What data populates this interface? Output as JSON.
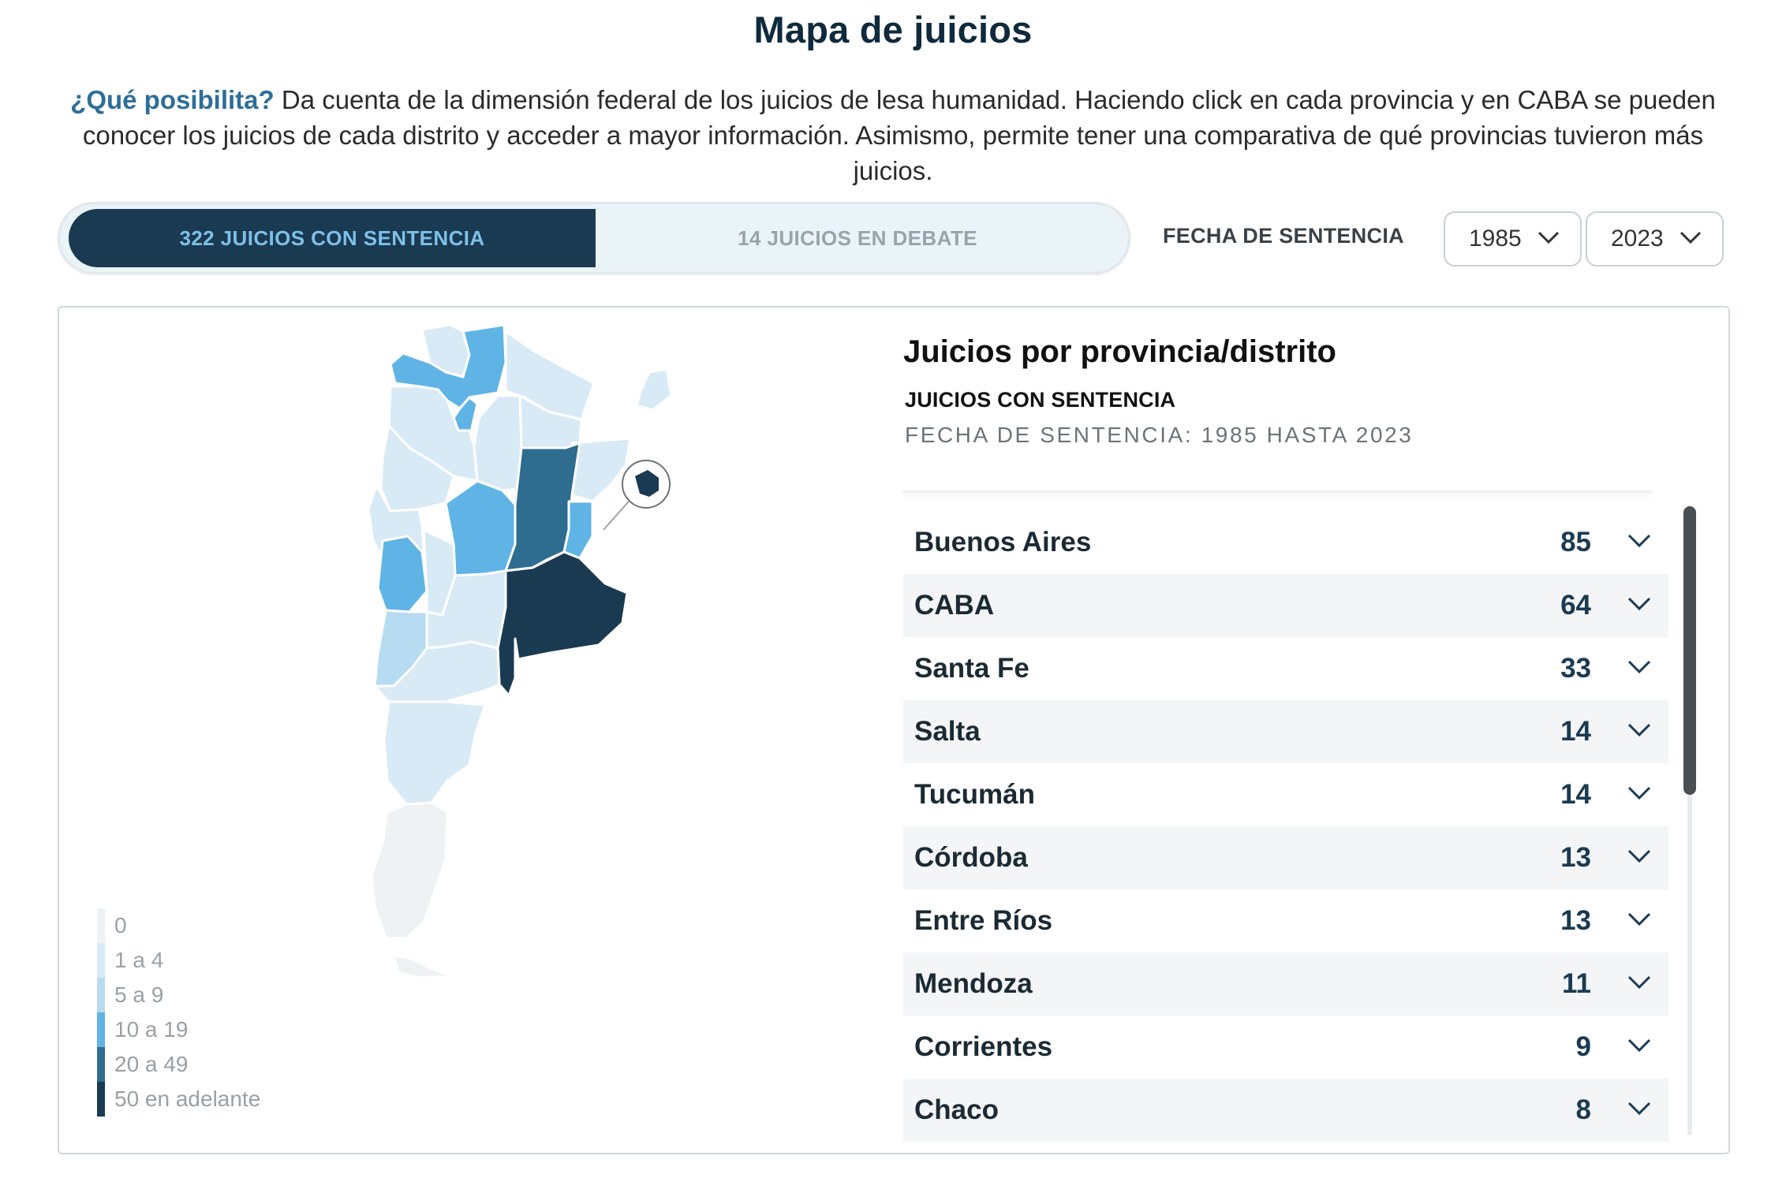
{
  "header": {
    "title": "Mapa de juicios",
    "intro_lead": "¿Qué posibilita?",
    "intro_text": " Da cuenta de la dimensión federal de los juicios de lesa humanidad. Haciendo click en cada provincia y en CABA se pueden conocer los juicios de cada distrito y acceder a mayor información. Asimismo, permite tener una comparativa de qué provincias tuvieron más juicios."
  },
  "toggle": {
    "active_label": "322 JUICIOS CON SENTENCIA",
    "inactive_label": "14 JUICIOS EN DEBATE"
  },
  "filters": {
    "date_label": "FECHA DE SENTENCIA",
    "from_year": "1985",
    "to_year": "2023"
  },
  "panel": {
    "title": "Juicios por provincia/distrito",
    "subtitle": "JUICIOS CON SENTENCIA",
    "range": "FECHA DE SENTENCIA: 1985 HASTA 2023",
    "rows": [
      {
        "name": "Buenos Aires",
        "count": "85"
      },
      {
        "name": "CABA",
        "count": "64"
      },
      {
        "name": "Santa Fe",
        "count": "33"
      },
      {
        "name": "Salta",
        "count": "14"
      },
      {
        "name": "Tucumán",
        "count": "14"
      },
      {
        "name": "Córdoba",
        "count": "13"
      },
      {
        "name": "Entre Ríos",
        "count": "13"
      },
      {
        "name": "Mendoza",
        "count": "11"
      },
      {
        "name": "Corrientes",
        "count": "9"
      },
      {
        "name": "Chaco",
        "count": "8"
      }
    ]
  },
  "legend": [
    {
      "label": "0",
      "color": "#eef2f5"
    },
    {
      "label": "1 a 4",
      "color": "#d8eaf6"
    },
    {
      "label": "5 a 9",
      "color": "#b7dcf1"
    },
    {
      "label": "10 a 19",
      "color": "#5fb4e5"
    },
    {
      "label": "20 a 49",
      "color": "#2e6d90"
    },
    {
      "label": "50 en adelante",
      "color": "#1a3a52"
    }
  ],
  "colors": {
    "accent_dark": "#1a3a52",
    "accent_light": "#7ec0e8",
    "lead": "#2e6e98"
  },
  "icons": {
    "select": "chevron-down-icon",
    "row": "chevron-down-icon"
  }
}
